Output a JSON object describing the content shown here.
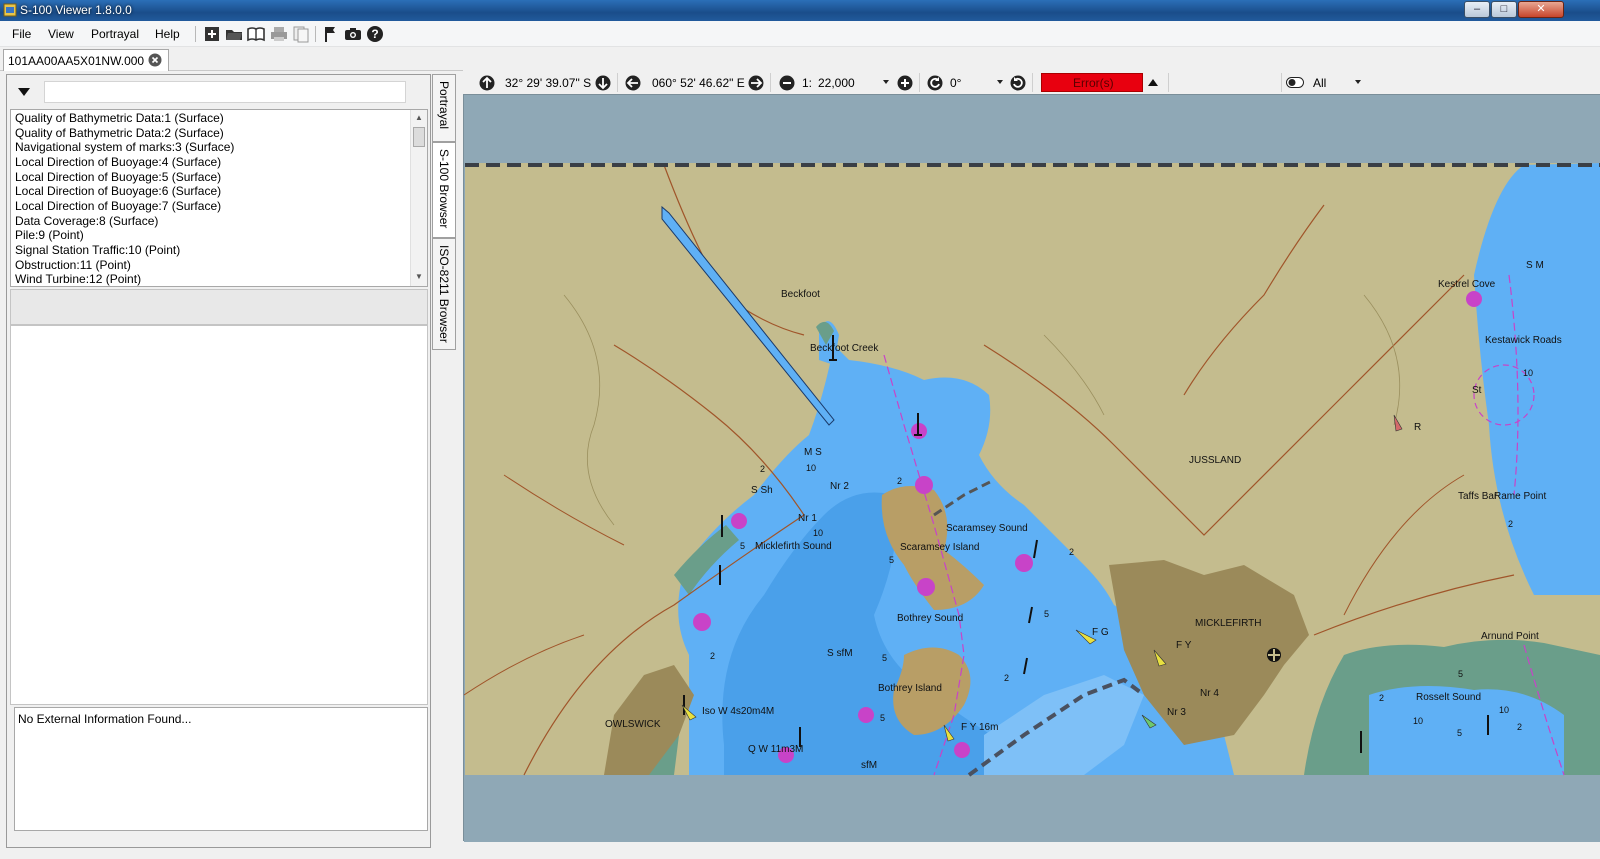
{
  "window": {
    "title": "S-100 Viewer 1.8.0.0"
  },
  "menu": {
    "file": "File",
    "view": "View",
    "portrayal": "Portrayal",
    "help": "Help"
  },
  "toolbar": {
    "icons": [
      "add-dataset-icon",
      "open-folder-icon",
      "catalogue-book-icon",
      "print-icon",
      "pages-icon",
      "flag-icon",
      "camera-icon",
      "help-icon"
    ]
  },
  "doc_tab": {
    "label": "101AA00AA5X01NW.000"
  },
  "left_panel": {
    "filter_value": "",
    "features": [
      "Quality of Bathymetric Data:1 (Surface)",
      "Quality of Bathymetric Data:2 (Surface)",
      "Navigational system of marks:3 (Surface)",
      "Local Direction of Buoyage:4 (Surface)",
      "Local Direction of Buoyage:5 (Surface)",
      "Local Direction of Buoyage:6 (Surface)",
      "Local Direction of Buoyage:7 (Surface)",
      "Data Coverage:8 (Surface)",
      "Pile:9 (Point)",
      "Signal Station Traffic:10 (Point)",
      "Obstruction:11 (Point)",
      "Wind Turbine:12 (Point)"
    ],
    "external_info": "No External Information Found..."
  },
  "side_tabs": {
    "portrayal": "Portrayal",
    "s100_browser": "S-100 Browser",
    "iso_browser": "ISO-8211 Browser"
  },
  "nav": {
    "latitude": "32° 29' 39.07\" S",
    "longitude": "060° 52' 46.62\" E",
    "scale_prefix": "1:",
    "scale": "22,000",
    "rotation": "0°",
    "error_label": "Error(s)",
    "filter_value": "All"
  },
  "colors": {
    "water": "#5fb0f5",
    "land": "#c4bc8e",
    "land_dark": "#a89a6c",
    "built": "#9b8a5a",
    "intertidal": "#6a9e8a",
    "surround": "#8fa8b6",
    "error": "#e8000f",
    "magenta": "#c843c8"
  },
  "map": {
    "place_names": [
      "Beckfoot",
      "Beckfoot Creek",
      "JUSSLAND",
      "Kestrel Cove",
      "Kestawick Roads",
      "MICKLEFIRTH",
      "Micklefirth Sound",
      "Scaramsey Island",
      "Scaramsey Sound",
      "Bothrey Sound",
      "Bothrey Island",
      "OWLSWICK",
      "Rosselt Sound",
      "Arnund Point",
      "Taffs Bar",
      "Rame Point",
      "S sfM",
      "M S",
      "S Sh",
      "Nr 1",
      "Nr 2",
      "Nr 3",
      "Nr 4",
      "F G",
      "F Y",
      "F Y 16m",
      "Iso W 4s20m4M",
      "Q W 11m3M",
      "sfM",
      "S M",
      "R",
      "St"
    ],
    "depths": [
      "2",
      "5",
      "10",
      "2",
      "5",
      "10",
      "2",
      "5",
      "2",
      "10",
      "2",
      "5",
      "2",
      "10",
      "5",
      "2",
      "10",
      "5",
      "2",
      "5"
    ]
  }
}
